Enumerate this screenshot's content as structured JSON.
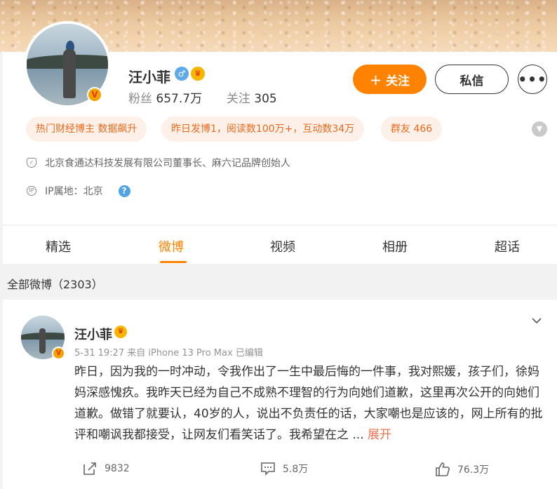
{
  "profile": {
    "name": "汪小菲",
    "stats": {
      "fans_label": "粉丝",
      "fans_value": "657.7万",
      "follow_label": "关注",
      "follow_value": "305"
    },
    "buttons": {
      "follow": "关注",
      "message": "私信",
      "more": "•••"
    },
    "tags": [
      "热门财经博主 数据飙升",
      "昨日发博1，阅读数100万+，互动数34万",
      "群友 466"
    ],
    "info": {
      "title": "北京食通达科技发展有限公司董事长、麻六记品牌创始人",
      "ip": "IP属地：北京"
    }
  },
  "tabs": [
    {
      "label": "精选",
      "active": false
    },
    {
      "label": "微博",
      "active": true
    },
    {
      "label": "视频",
      "active": false
    },
    {
      "label": "相册",
      "active": false
    },
    {
      "label": "超话",
      "active": false
    }
  ],
  "feed": {
    "all_posts_label": "全部微博（2303）"
  },
  "post": {
    "author": "汪小菲",
    "meta": "5-31 19:27  来自 iPhone 13 Pro Max 已编辑",
    "text": "昨日，因为我的一时冲动，令我作出了一生中最后悔的一件事，我对熙媛，孩子们，徐妈妈深感愧疚。我昨天已经为自己不成熟不理智的行为向她们道歉，这里再次公开的向她们道歉。做错了就要认，40岁的人，说出不负责任的话，大家嘲也是应该的，网上所有的批评和嘲讽我都接受，让网友们看笑话了。我希望在之 ...",
    "expand": "展开",
    "reposts": "9832",
    "comments": "5.8万",
    "likes": "76.3万"
  },
  "colors": {
    "accent": "#ff8200",
    "tag_bg": "#fdf0e8",
    "tag_text": "#ea6a1c",
    "link": "#eb7350",
    "verify_blue": "#5eaae8"
  }
}
